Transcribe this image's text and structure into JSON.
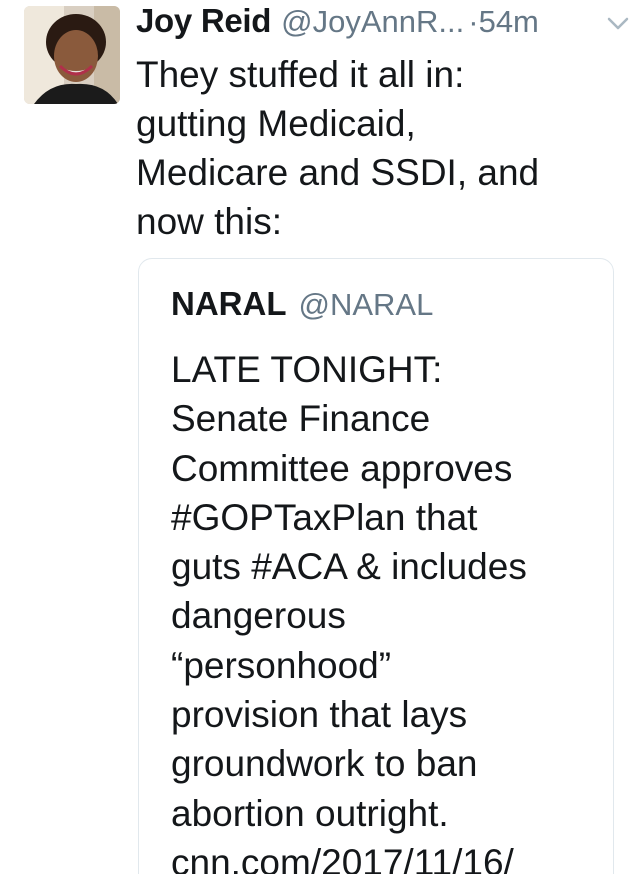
{
  "tweet": {
    "author_name": "Joy Reid",
    "author_handle": "@JoyAnnR...",
    "time": "·54m",
    "text": "They stuffed it all in:\ngutting Medicaid,\nMedicare and SSDI, and\nnow this:",
    "icons": {
      "avatar": "profile-photo",
      "menu": "chevron-down-icon"
    },
    "quoted": {
      "author_name": "NARAL",
      "author_handle": "@NARAL",
      "text": "LATE TONIGHT:\nSenate Finance\nCommittee approves\n#GOPTaxPlan that\nguts #ACA & includes\ndangerous\n“personhood”\nprovision that lays\ngroundwork to ban\nabortion outright.\ncnn.com/2017/11/16/"
    }
  },
  "colors": {
    "text": "#14171a",
    "secondary": "#657786",
    "border": "#e1e8ed"
  }
}
